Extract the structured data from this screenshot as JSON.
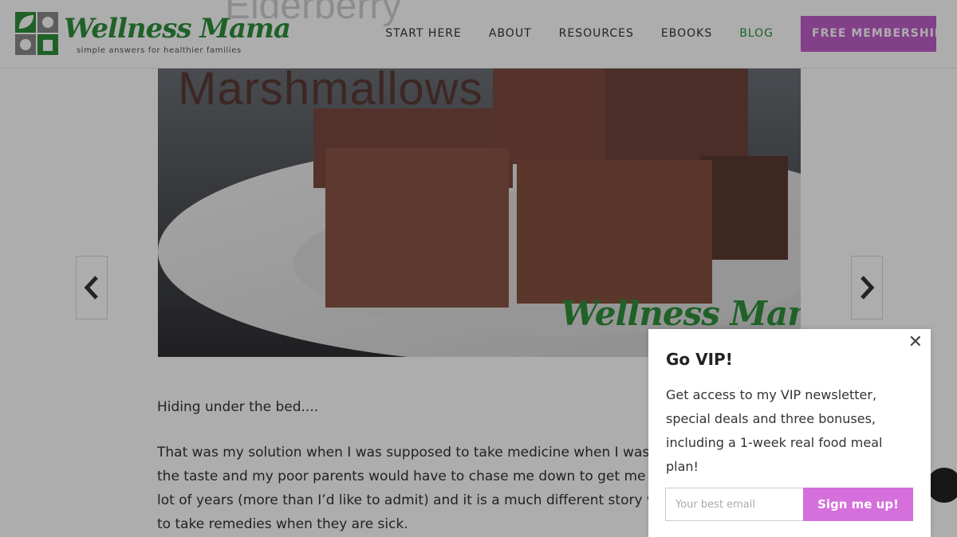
{
  "header": {
    "logo": {
      "wordmark": "Wellness Mama",
      "tagline": "simple answers for healthier families"
    },
    "nav": [
      {
        "label": "START HERE",
        "active": false
      },
      {
        "label": "ABOUT",
        "active": false
      },
      {
        "label": "RESOURCES",
        "active": false
      },
      {
        "label": "EBOOKS",
        "active": false
      },
      {
        "label": "BLOG",
        "active": true
      }
    ],
    "cta_label": "FREE MEMBERSHIP"
  },
  "hero": {
    "title_line1_partial": "Elderberry",
    "title_line2": "Marshmallows",
    "watermark": "Wellness Mama"
  },
  "article": {
    "paragraphs": [
      [
        "Hiding under the bed...."
      ],
      [
        "That was my solution when I was supposed to take medicine when I was si",
        "the taste and my poor parents would have to chase me down to get me to",
        "lot of years (more than I’d like to admit) and it is a much different story whe",
        "to take remedies when they are sick."
      ]
    ]
  },
  "popup": {
    "title": "Go VIP!",
    "body": "Get access to my VIP newsletter, special deals and three bonuses, including a 1-week real food meal plan!",
    "email_placeholder": "Your best email",
    "submit_label": "Sign me up!"
  },
  "colors": {
    "brand_green": "#2f8f3a",
    "brand_purple": "#c05fc9",
    "submit_purple": "#d46fdb",
    "overlay": "rgba(0,0,0,0.32)"
  },
  "icons": [
    "leaf-logo-icon",
    "chevron-left-icon",
    "chevron-right-icon",
    "close-icon"
  ]
}
